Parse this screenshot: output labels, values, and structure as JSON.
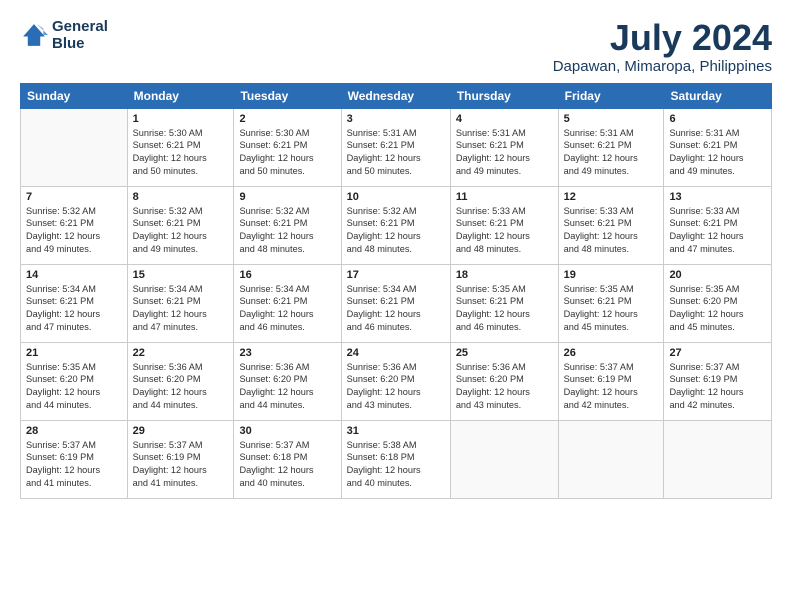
{
  "header": {
    "logo_line1": "General",
    "logo_line2": "Blue",
    "month": "July 2024",
    "location": "Dapawan, Mimaropa, Philippines"
  },
  "days_of_week": [
    "Sunday",
    "Monday",
    "Tuesday",
    "Wednesday",
    "Thursday",
    "Friday",
    "Saturday"
  ],
  "weeks": [
    [
      {
        "num": "",
        "info": ""
      },
      {
        "num": "1",
        "info": "Sunrise: 5:30 AM\nSunset: 6:21 PM\nDaylight: 12 hours\nand 50 minutes."
      },
      {
        "num": "2",
        "info": "Sunrise: 5:30 AM\nSunset: 6:21 PM\nDaylight: 12 hours\nand 50 minutes."
      },
      {
        "num": "3",
        "info": "Sunrise: 5:31 AM\nSunset: 6:21 PM\nDaylight: 12 hours\nand 50 minutes."
      },
      {
        "num": "4",
        "info": "Sunrise: 5:31 AM\nSunset: 6:21 PM\nDaylight: 12 hours\nand 49 minutes."
      },
      {
        "num": "5",
        "info": "Sunrise: 5:31 AM\nSunset: 6:21 PM\nDaylight: 12 hours\nand 49 minutes."
      },
      {
        "num": "6",
        "info": "Sunrise: 5:31 AM\nSunset: 6:21 PM\nDaylight: 12 hours\nand 49 minutes."
      }
    ],
    [
      {
        "num": "7",
        "info": "Sunrise: 5:32 AM\nSunset: 6:21 PM\nDaylight: 12 hours\nand 49 minutes."
      },
      {
        "num": "8",
        "info": "Sunrise: 5:32 AM\nSunset: 6:21 PM\nDaylight: 12 hours\nand 49 minutes."
      },
      {
        "num": "9",
        "info": "Sunrise: 5:32 AM\nSunset: 6:21 PM\nDaylight: 12 hours\nand 48 minutes."
      },
      {
        "num": "10",
        "info": "Sunrise: 5:32 AM\nSunset: 6:21 PM\nDaylight: 12 hours\nand 48 minutes."
      },
      {
        "num": "11",
        "info": "Sunrise: 5:33 AM\nSunset: 6:21 PM\nDaylight: 12 hours\nand 48 minutes."
      },
      {
        "num": "12",
        "info": "Sunrise: 5:33 AM\nSunset: 6:21 PM\nDaylight: 12 hours\nand 48 minutes."
      },
      {
        "num": "13",
        "info": "Sunrise: 5:33 AM\nSunset: 6:21 PM\nDaylight: 12 hours\nand 47 minutes."
      }
    ],
    [
      {
        "num": "14",
        "info": "Sunrise: 5:34 AM\nSunset: 6:21 PM\nDaylight: 12 hours\nand 47 minutes."
      },
      {
        "num": "15",
        "info": "Sunrise: 5:34 AM\nSunset: 6:21 PM\nDaylight: 12 hours\nand 47 minutes."
      },
      {
        "num": "16",
        "info": "Sunrise: 5:34 AM\nSunset: 6:21 PM\nDaylight: 12 hours\nand 46 minutes."
      },
      {
        "num": "17",
        "info": "Sunrise: 5:34 AM\nSunset: 6:21 PM\nDaylight: 12 hours\nand 46 minutes."
      },
      {
        "num": "18",
        "info": "Sunrise: 5:35 AM\nSunset: 6:21 PM\nDaylight: 12 hours\nand 46 minutes."
      },
      {
        "num": "19",
        "info": "Sunrise: 5:35 AM\nSunset: 6:21 PM\nDaylight: 12 hours\nand 45 minutes."
      },
      {
        "num": "20",
        "info": "Sunrise: 5:35 AM\nSunset: 6:20 PM\nDaylight: 12 hours\nand 45 minutes."
      }
    ],
    [
      {
        "num": "21",
        "info": "Sunrise: 5:35 AM\nSunset: 6:20 PM\nDaylight: 12 hours\nand 44 minutes."
      },
      {
        "num": "22",
        "info": "Sunrise: 5:36 AM\nSunset: 6:20 PM\nDaylight: 12 hours\nand 44 minutes."
      },
      {
        "num": "23",
        "info": "Sunrise: 5:36 AM\nSunset: 6:20 PM\nDaylight: 12 hours\nand 44 minutes."
      },
      {
        "num": "24",
        "info": "Sunrise: 5:36 AM\nSunset: 6:20 PM\nDaylight: 12 hours\nand 43 minutes."
      },
      {
        "num": "25",
        "info": "Sunrise: 5:36 AM\nSunset: 6:20 PM\nDaylight: 12 hours\nand 43 minutes."
      },
      {
        "num": "26",
        "info": "Sunrise: 5:37 AM\nSunset: 6:19 PM\nDaylight: 12 hours\nand 42 minutes."
      },
      {
        "num": "27",
        "info": "Sunrise: 5:37 AM\nSunset: 6:19 PM\nDaylight: 12 hours\nand 42 minutes."
      }
    ],
    [
      {
        "num": "28",
        "info": "Sunrise: 5:37 AM\nSunset: 6:19 PM\nDaylight: 12 hours\nand 41 minutes."
      },
      {
        "num": "29",
        "info": "Sunrise: 5:37 AM\nSunset: 6:19 PM\nDaylight: 12 hours\nand 41 minutes."
      },
      {
        "num": "30",
        "info": "Sunrise: 5:37 AM\nSunset: 6:18 PM\nDaylight: 12 hours\nand 40 minutes."
      },
      {
        "num": "31",
        "info": "Sunrise: 5:38 AM\nSunset: 6:18 PM\nDaylight: 12 hours\nand 40 minutes."
      },
      {
        "num": "",
        "info": ""
      },
      {
        "num": "",
        "info": ""
      },
      {
        "num": "",
        "info": ""
      }
    ]
  ]
}
